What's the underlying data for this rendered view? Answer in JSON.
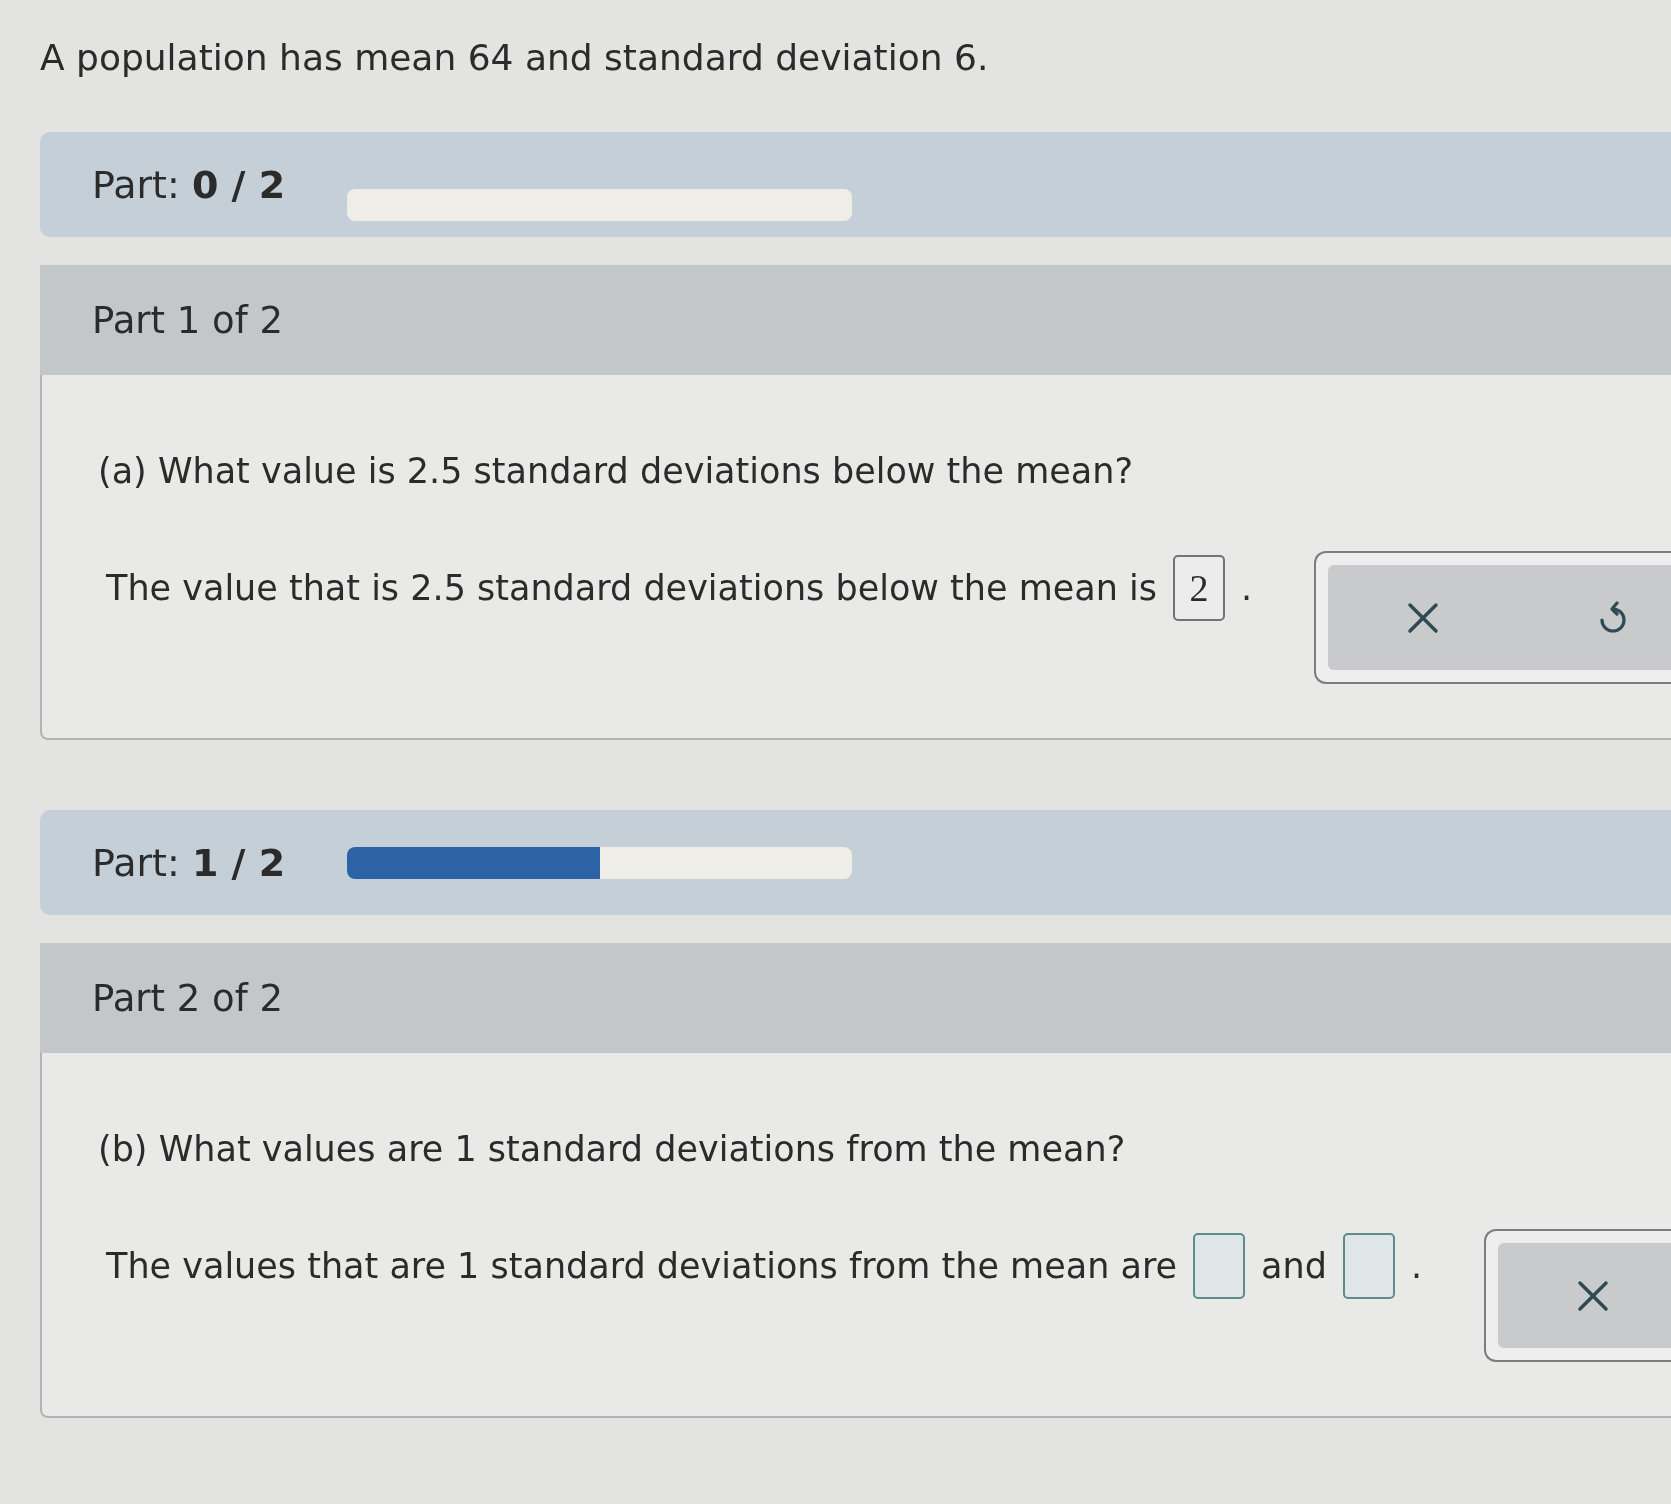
{
  "problem": {
    "statement": "A population has mean 64 and standard deviation 6."
  },
  "parts": [
    {
      "progress": {
        "label": "Part: **0 / 2**"
      },
      "header": "Part 1 of 2",
      "question": "(a) What value is 2.5 standard deviations below the mean?",
      "answer": [
        {
          "kind": "text",
          "text": "The value that is 2.5 standard deviations below the mean is"
        },
        {
          "kind": "field",
          "value": "2"
        },
        {
          "kind": "text",
          "text": "."
        }
      ],
      "actions": [
        {
          "kind": "clear"
        },
        {
          "kind": "undo"
        }
      ]
    },
    {
      "progress": {
        "label": "Part: **1 / 2**",
        "level": 0.5
      },
      "header": "Part 2 of 2",
      "question": "(b) What values are 1 standard deviations from the mean?",
      "answer": [
        {
          "kind": "text",
          "text": "The values that are 1 standard deviations from the mean are"
        },
        {
          "kind": "field"
        },
        {
          "kind": "text",
          "text": "and"
        },
        {
          "kind": "field"
        },
        {
          "kind": "text",
          "text": "."
        }
      ],
      "actions": [
        {
          "kind": "clear"
        }
      ]
    }
  ]
}
